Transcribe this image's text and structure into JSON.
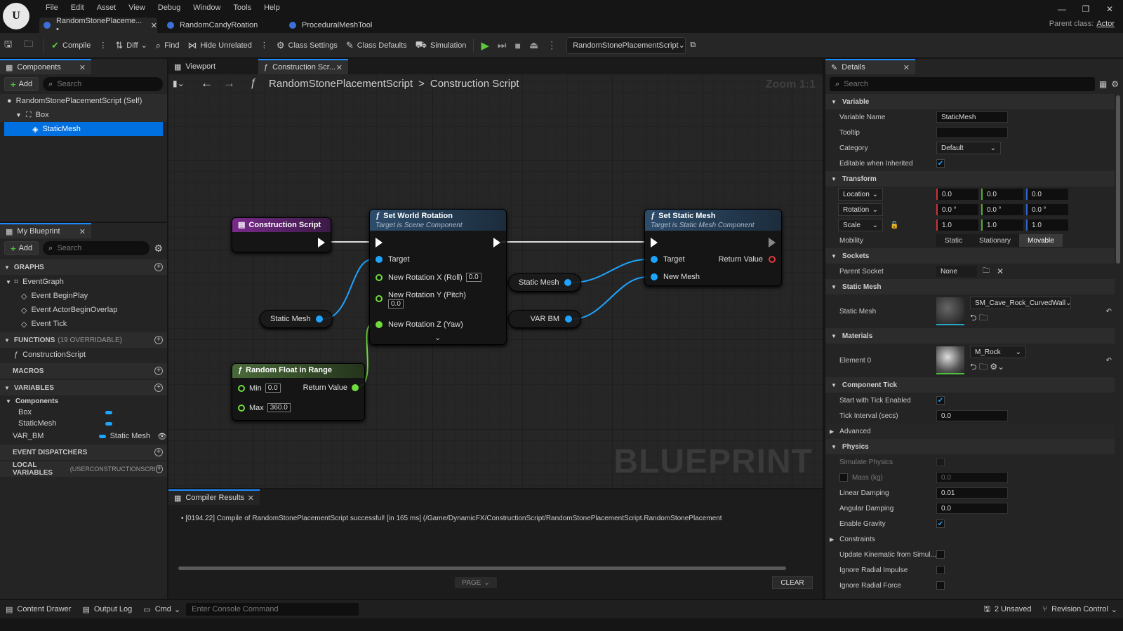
{
  "app": {
    "logo": "U",
    "menu": [
      "File",
      "Edit",
      "Asset",
      "View",
      "Debug",
      "Window",
      "Tools",
      "Help"
    ],
    "tabs": [
      {
        "label": "RandomStonePlaceme... •"
      },
      {
        "label": "RandomCandyRoation"
      },
      {
        "label": "ProceduralMeshTool"
      }
    ],
    "parent_class_label": "Parent class:",
    "parent_class_value": "Actor"
  },
  "toolbar": {
    "compile": "Compile",
    "diff": "Diff",
    "find": "Find",
    "hide_unrelated": "Hide Unrelated",
    "class_settings": "Class Settings",
    "class_defaults": "Class Defaults",
    "simulation": "Simulation",
    "debug_object": "RandomStonePlacementScript"
  },
  "components": {
    "tab": "Components",
    "add": "Add",
    "search_placeholder": "Search",
    "items": [
      "RandomStonePlacementScript (Self)",
      "Box",
      "StaticMesh"
    ]
  },
  "myblueprint": {
    "tab": "My Blueprint",
    "add": "Add",
    "search_placeholder": "Search",
    "graphs_label": "GRAPHS",
    "eventgraph": "EventGraph",
    "events": [
      "Event BeginPlay",
      "Event ActorBeginOverlap",
      "Event Tick"
    ],
    "functions_label": "FUNCTIONS",
    "functions_note": "(19 OVERRIDABLE)",
    "function_items": [
      "ConstructionScript"
    ],
    "macros_label": "MACROS",
    "variables_label": "VARIABLES",
    "var_group": "Components",
    "vars": [
      "Box",
      "StaticMesh"
    ],
    "var_bm": "VAR_BM",
    "var_bm_type": "Static Mesh",
    "dispatchers_label": "EVENT DISPATCHERS",
    "local_label": "LOCAL VARIABLES",
    "local_note": "(USERCONSTRUCTIONSCRI"
  },
  "graph": {
    "tab_viewport": "Viewport",
    "tab_construction": "Construction Scr...",
    "breadcrumb_root": "RandomStonePlacementScript",
    "breadcrumb_sep": ">",
    "breadcrumb_leaf": "Construction Script",
    "zoom": "Zoom 1:1",
    "watermark": "BLUEPRINT",
    "construction_node": "Construction Script",
    "swr_title": "Set World Rotation",
    "swr_sub": "Target is Scene Component",
    "swr_target": "Target",
    "swr_rx": "New Rotation X (Roll)",
    "swr_rx_val": "0.0",
    "swr_ry": "New Rotation Y (Pitch)",
    "swr_ry_val": "0.0",
    "swr_rz": "New Rotation Z (Yaw)",
    "ssm_title": "Set Static Mesh",
    "ssm_sub": "Target is Static Mesh Component",
    "ssm_target": "Target",
    "ssm_return": "Return Value",
    "ssm_newmesh": "New Mesh",
    "var_static_mesh_1": "Static Mesh",
    "var_static_mesh_2": "Static Mesh",
    "var_bm": "VAR BM",
    "rf_title": "Random Float in Range",
    "rf_min": "Min",
    "rf_min_val": "0.0",
    "rf_max": "Max",
    "rf_max_val": "360.0",
    "rf_return": "Return Value"
  },
  "compiler": {
    "tab": "Compiler Results",
    "message": "[0194.22] Compile of RandomStonePlacementScript successful! [in 165 ms] (/Game/DynamicFX/ConstructionScript/RandomStonePlacementScript.RandomStonePlacement",
    "page": "PAGE",
    "clear": "CLEAR"
  },
  "details": {
    "tab": "Details",
    "search_placeholder": "Search",
    "s_variable": "Variable",
    "variable_name_label": "Variable Name",
    "variable_name": "StaticMesh",
    "tooltip_label": "Tooltip",
    "category_label": "Category",
    "category": "Default",
    "editable_label": "Editable when Inherited",
    "s_transform": "Transform",
    "location": "Location",
    "rotation": "Rotation",
    "scale": "Scale",
    "loc": [
      "0.0",
      "0.0",
      "0.0"
    ],
    "rot": [
      "0.0 °",
      "0.0 °",
      "0.0 °"
    ],
    "scl": [
      "1.0",
      "1.0",
      "1.0"
    ],
    "mobility_label": "Mobility",
    "mobility": [
      "Static",
      "Stationary",
      "Movable"
    ],
    "s_sockets": "Sockets",
    "parent_socket_label": "Parent Socket",
    "parent_socket": "None",
    "s_static_mesh": "Static Mesh",
    "static_mesh_label": "Static Mesh",
    "static_mesh_value": "SM_Cave_Rock_CurvedWall",
    "s_materials": "Materials",
    "element0_label": "Element 0",
    "element0_value": "M_Rock",
    "s_tick": "Component Tick",
    "start_tick_label": "Start with Tick Enabled",
    "tick_interval_label": "Tick Interval (secs)",
    "tick_interval": "0.0",
    "advanced": "Advanced",
    "s_physics": "Physics",
    "simulate_label": "Simulate Physics",
    "mass_label": "Mass (kg)",
    "mass": "0.0",
    "linear_label": "Linear Damping",
    "linear": "0.01",
    "angular_label": "Angular Damping",
    "angular": "0.0",
    "gravity_label": "Enable Gravity",
    "constraints": "Constraints",
    "update_kin_label": "Update Kinematic from Simul...",
    "radial_impulse_label": "Ignore Radial Impulse",
    "radial_force_label": "Ignore Radial Force"
  },
  "status": {
    "content_drawer": "Content Drawer",
    "output_log": "Output Log",
    "cmd": "Cmd",
    "console_placeholder": "Enter Console Command",
    "unsaved": "2 Unsaved",
    "revision": "Revision Control"
  }
}
